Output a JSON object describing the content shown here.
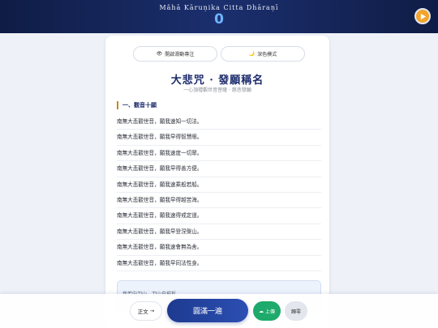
{
  "header": {
    "title": "Mâhā Kāruṇika Citta Dhāraṇī",
    "count": "0"
  },
  "toggles": {
    "scroll_focus": {
      "icon": "👁",
      "label": "開啟滑動專注"
    },
    "dark_mode": {
      "icon": "🌙",
      "label": "深色模式"
    }
  },
  "card": {
    "title": "大悲咒 · 發願稱名",
    "subtitle": "一心頂禮觀世音菩薩 · 慈悲發願",
    "section": "一、觀音十願",
    "vows": [
      "南無大悲觀世音，願我速知一切法。",
      "南無大悲觀世音，願我早得智慧眼。",
      "南無大悲觀世音，願我速度一切眾。",
      "南無大悲觀世音，願我早得善方便。",
      "南無大悲觀世音，願我速乘般若船。",
      "南無大悲觀世音，願我早得越苦海。",
      "南無大悲觀世音，願我速得戒定道。",
      "南無大悲觀世音，願我早登涅槃山。",
      "南無大悲觀世音，願我速會無為舍。",
      "南無大悲觀世音，願我早同法性身。"
    ],
    "note": "我若向刀山，刀山自摧折。"
  },
  "bottom": {
    "text_label": "正文",
    "text_arrow": "→",
    "complete_label": "圓滿一遍",
    "upload_icon": "☁",
    "upload_label": "上傳",
    "reset_label": "歸零"
  },
  "colors": {
    "header_bg": "#15275c",
    "counter": "#6fb4ff",
    "play": "#f2a42d",
    "accent": "#c48a1f",
    "primary": "#1d3a8f",
    "upload": "#1eaa6a"
  }
}
